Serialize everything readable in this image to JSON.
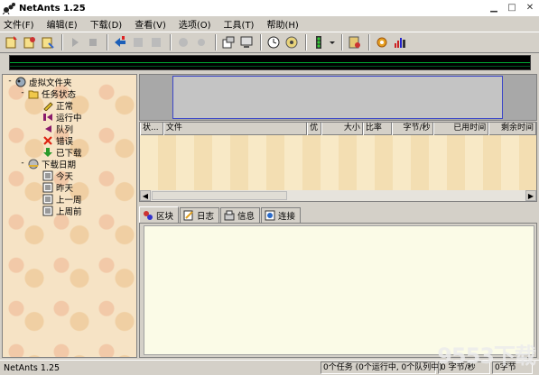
{
  "window": {
    "title": "NetAnts 1.25",
    "icon": "ant-icon"
  },
  "menu": [
    "文件(F)",
    "编辑(E)",
    "下载(D)",
    "查看(V)",
    "选项(O)",
    "工具(T)",
    "帮助(H)"
  ],
  "toolbar_icons": [
    "new-task-icon",
    "copy-task-icon",
    "paste-task-icon",
    "start-icon",
    "stop-icon",
    "download-all-icon",
    "schedule-icon",
    "delete-icon",
    "connect-icon",
    "settings-icon",
    "properties-icon",
    "monitor-icon",
    "clock-icon",
    "folders-icon",
    "traffic-light-icon",
    "dropdown-arrow-icon",
    "ant-status-icon",
    "options-gear-icon",
    "stats-icon"
  ],
  "tree": {
    "root": "虚拟文件夹",
    "task_status": "任务状态",
    "status_items": [
      "正常",
      "运行中",
      "队列",
      "错误",
      "已下载"
    ],
    "download_date": "下载日期",
    "date_items": [
      "今天",
      "昨天",
      "上一周",
      "上周前"
    ]
  },
  "list_columns": [
    "状...",
    "文件",
    "优",
    "大小",
    "比率",
    "字节/秒",
    "已用时间",
    "剩余时间"
  ],
  "tabs": [
    "区块",
    "日志",
    "信息",
    "连接"
  ],
  "statusbar": {
    "app": "NetAnts 1.25",
    "tasks": "0个任务 (0个运行中, 0个队列中)",
    "bytes_per_sec": "0 字节/秒",
    "bytes": "0字节"
  },
  "watermark": "9553下载",
  "colors": {
    "graph_border": "#3b46c8",
    "speed_bg": "#000000",
    "tree_bg": "#f6e3c5",
    "detail_bg": "#fbfbe7"
  }
}
